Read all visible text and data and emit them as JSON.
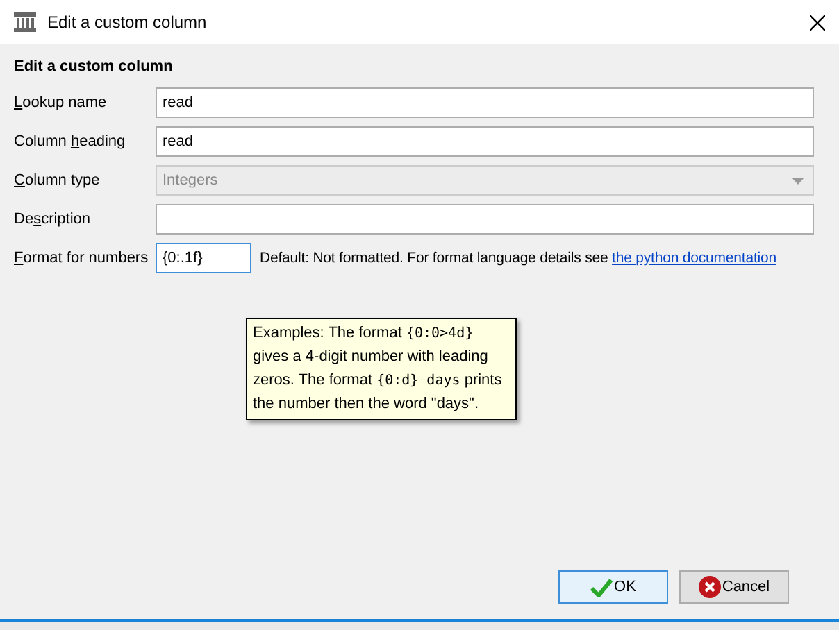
{
  "window": {
    "title": "Edit a custom column"
  },
  "heading": "Edit a custom column",
  "fields": [
    {
      "kind": "text",
      "label": {
        "key": "L",
        "post": "ookup name"
      },
      "value": "read",
      "disabled": false
    },
    {
      "kind": "text",
      "label": {
        "pre": "Column ",
        "key": "h",
        "post": "eading"
      },
      "value": "read",
      "disabled": false
    },
    {
      "kind": "select",
      "label": {
        "key": "C",
        "post": "olumn type"
      },
      "value": "Integers",
      "disabled": true
    },
    {
      "kind": "text",
      "label": {
        "pre": "De",
        "key": "s",
        "post": "cription"
      },
      "disabled": false
    },
    {
      "kind": "format",
      "label": {
        "key": "F",
        "post": "ormat for numbers"
      },
      "value": "{0:.1f}",
      "disabled": false,
      "note": "Default: Not formatted. For format language details see",
      "link": "the python documentation"
    }
  ],
  "tooltip": [
    {
      "kind": "text",
      "text": "Examples: The format "
    },
    {
      "kind": "code",
      "text": "{0:0>4d}"
    },
    {
      "kind": "text",
      "text": " gives a 4-digit number with leading zeros. The format "
    },
    {
      "kind": "code",
      "text": "{0:d} days"
    },
    {
      "kind": "text",
      "text": " prints the number then the word \"days\"."
    }
  ],
  "buttons": [
    {
      "kind": "ok",
      "label": "OK"
    },
    {
      "kind": "cancel",
      "label": "Cancel"
    }
  ]
}
